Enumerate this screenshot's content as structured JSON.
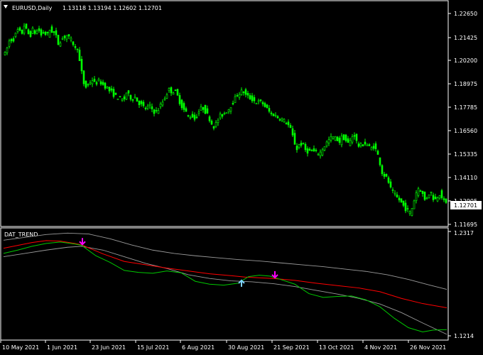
{
  "main_chart": {
    "symbol_label": "EURUSD,Daily",
    "ohlc_label": "1.13118 1.13194 1.12602 1.12701",
    "current_price": "1.12701",
    "price_ticks": [
      "1.22650",
      "1.21425",
      "1.20200",
      "1.18975",
      "1.17785",
      "1.16560",
      "1.15335",
      "1.14110",
      "1.12905",
      "1.11695"
    ],
    "colors": {
      "background": "#000000",
      "candle": "#00ff00",
      "frame": "#ffffff"
    }
  },
  "indicator": {
    "name": "DAT_TREND",
    "scale_top": "1.2317",
    "scale_bottom": "1.1214",
    "colors": {
      "fast": "#00c800",
      "slow": "#ff0000",
      "band": "#9a9a9a",
      "arrow_down": "#ff00ff",
      "arrow_up": "#7fd4ff"
    }
  },
  "time_axis": [
    "10 May 2021",
    "1 Jun 2021",
    "23 Jun 2021",
    "15 Jul 2021",
    "6 Aug 2021",
    "30 Aug 2021",
    "21 Sep 2021",
    "13 Oct 2021",
    "4 Nov 2021",
    "26 Nov 2021"
  ],
  "chart_data": {
    "type": "candlestick",
    "symbol": "EURUSD",
    "timeframe": "Daily",
    "y_range": [
      1.1155,
      1.2315
    ],
    "indicator_range": [
      1.1214,
      1.2317
    ],
    "close_path": [
      [
        0,
        1.213
      ],
      [
        4,
        1.208
      ],
      [
        8,
        1.2125
      ],
      [
        12,
        1.2175
      ],
      [
        16,
        1.2165
      ],
      [
        20,
        1.22
      ],
      [
        24,
        1.223
      ],
      [
        28,
        1.2195
      ],
      [
        32,
        1.225
      ],
      [
        36,
        1.2215
      ],
      [
        40,
        1.219
      ],
      [
        44,
        1.2225
      ],
      [
        48,
        1.2205
      ],
      [
        52,
        1.223
      ],
      [
        56,
        1.2195
      ],
      [
        60,
        1.2215
      ],
      [
        64,
        1.219
      ],
      [
        68,
        1.2225
      ],
      [
        72,
        1.2215
      ],
      [
        76,
        1.22
      ],
      [
        80,
        1.215
      ],
      [
        84,
        1.217
      ],
      [
        88,
        1.2185
      ],
      [
        92,
        1.2195
      ],
      [
        96,
        1.2175
      ],
      [
        100,
        1.216
      ],
      [
        104,
        1.212
      ],
      [
        108,
        1.213
      ],
      [
        110,
        1.205
      ],
      [
        113,
        1.199
      ],
      [
        116,
        1.193
      ],
      [
        120,
        1.1905
      ],
      [
        124,
        1.1935
      ],
      [
        128,
        1.195
      ],
      [
        132,
        1.1925
      ],
      [
        136,
        1.1945
      ],
      [
        140,
        1.1935
      ],
      [
        144,
        1.192
      ],
      [
        148,
        1.191
      ],
      [
        152,
        1.189
      ],
      [
        156,
        1.188
      ],
      [
        160,
        1.186
      ],
      [
        164,
        1.1855
      ],
      [
        168,
        1.1845
      ],
      [
        172,
        1.1835
      ],
      [
        176,
        1.188
      ],
      [
        180,
        1.186
      ],
      [
        184,
        1.1845
      ],
      [
        188,
        1.1855
      ],
      [
        192,
        1.183
      ],
      [
        196,
        1.1815
      ],
      [
        200,
        1.18
      ],
      [
        204,
        1.179
      ],
      [
        208,
        1.181
      ],
      [
        212,
        1.179
      ],
      [
        216,
        1.177
      ],
      [
        220,
        1.178
      ],
      [
        224,
        1.181
      ],
      [
        228,
        1.1835
      ],
      [
        232,
        1.187
      ],
      [
        236,
        1.1895
      ],
      [
        240,
        1.1885
      ],
      [
        244,
        1.189
      ],
      [
        248,
        1.186
      ],
      [
        252,
        1.182
      ],
      [
        256,
        1.179
      ],
      [
        260,
        1.177
      ],
      [
        264,
        1.1745
      ],
      [
        268,
        1.1755
      ],
      [
        272,
        1.1735
      ],
      [
        276,
        1.176
      ],
      [
        280,
        1.179
      ],
      [
        284,
        1.1795
      ],
      [
        288,
        1.177
      ],
      [
        292,
        1.1745
      ],
      [
        296,
        1.171
      ],
      [
        300,
        1.169
      ],
      [
        304,
        1.1725
      ],
      [
        308,
        1.175
      ],
      [
        312,
        1.176
      ],
      [
        316,
        1.1775
      ],
      [
        320,
        1.179
      ],
      [
        324,
        1.1815
      ],
      [
        328,
        1.184
      ],
      [
        332,
        1.187
      ],
      [
        336,
        1.188
      ],
      [
        340,
        1.189
      ],
      [
        344,
        1.1865
      ],
      [
        348,
        1.1855
      ],
      [
        352,
        1.1845
      ],
      [
        356,
        1.1835
      ],
      [
        360,
        1.1825
      ],
      [
        364,
        1.183
      ],
      [
        368,
        1.182
      ],
      [
        372,
        1.18
      ],
      [
        376,
        1.178
      ],
      [
        380,
        1.176
      ],
      [
        384,
        1.176
      ],
      [
        388,
        1.1745
      ],
      [
        392,
        1.174
      ],
      [
        396,
        1.173
      ],
      [
        400,
        1.172
      ],
      [
        404,
        1.17
      ],
      [
        408,
        1.167
      ],
      [
        412,
        1.161
      ],
      [
        416,
        1.157
      ],
      [
        420,
        1.16
      ],
      [
        424,
        1.1595
      ],
      [
        428,
        1.1565
      ],
      [
        432,
        1.1555
      ],
      [
        436,
        1.156
      ],
      [
        440,
        1.1555
      ],
      [
        444,
        1.155
      ],
      [
        448,
        1.1545
      ],
      [
        452,
        1.157
      ],
      [
        456,
        1.1595
      ],
      [
        460,
        1.1615
      ],
      [
        464,
        1.163
      ],
      [
        468,
        1.1635
      ],
      [
        472,
        1.1625
      ],
      [
        476,
        1.161
      ],
      [
        480,
        1.164
      ],
      [
        484,
        1.162
      ],
      [
        488,
        1.16
      ],
      [
        492,
        1.162
      ],
      [
        496,
        1.166
      ],
      [
        500,
        1.161
      ],
      [
        504,
        1.158
      ],
      [
        508,
        1.1595
      ],
      [
        512,
        1.16
      ],
      [
        516,
        1.159
      ],
      [
        520,
        1.157
      ],
      [
        524,
        1.1585
      ],
      [
        528,
        1.156
      ],
      [
        532,
        1.151
      ],
      [
        536,
        1.144
      ],
      [
        540,
        1.142
      ],
      [
        544,
        1.14
      ],
      [
        548,
        1.135
      ],
      [
        552,
        1.1325
      ],
      [
        556,
        1.1305
      ],
      [
        560,
        1.129
      ],
      [
        564,
        1.127
      ],
      [
        568,
        1.1245
      ],
      [
        572,
        1.123
      ],
      [
        576,
        1.1215
      ],
      [
        580,
        1.1275
      ],
      [
        584,
        1.133
      ],
      [
        588,
        1.136
      ],
      [
        592,
        1.133
      ],
      [
        596,
        1.129
      ],
      [
        600,
        1.131
      ],
      [
        604,
        1.134
      ],
      [
        608,
        1.13
      ],
      [
        612,
        1.129
      ],
      [
        616,
        1.133
      ],
      [
        620,
        1.131
      ],
      [
        624,
        1.127
      ]
    ],
    "indicator_lines": {
      "fast": [
        [
          0,
          1.2085
        ],
        [
          20,
          1.212
        ],
        [
          40,
          1.216
        ],
        [
          60,
          1.219
        ],
        [
          80,
          1.2205
        ],
        [
          100,
          1.2185
        ],
        [
          110,
          1.217
        ],
        [
          130,
          1.206
        ],
        [
          150,
          1.199
        ],
        [
          170,
          1.1905
        ],
        [
          190,
          1.1885
        ],
        [
          210,
          1.1875
        ],
        [
          230,
          1.19
        ],
        [
          250,
          1.188
        ],
        [
          270,
          1.179
        ],
        [
          290,
          1.176
        ],
        [
          310,
          1.175
        ],
        [
          330,
          1.177
        ],
        [
          345,
          1.184
        ],
        [
          360,
          1.1855
        ],
        [
          375,
          1.1845
        ],
        [
          390,
          1.181
        ],
        [
          410,
          1.176
        ],
        [
          430,
          1.166
        ],
        [
          450,
          1.162
        ],
        [
          470,
          1.163
        ],
        [
          490,
          1.1635
        ],
        [
          510,
          1.1595
        ],
        [
          530,
          1.152
        ],
        [
          550,
          1.14
        ],
        [
          570,
          1.13
        ],
        [
          590,
          1.1255
        ],
        [
          605,
          1.1275
        ],
        [
          624,
          1.128
        ]
      ],
      "slow": [
        [
          0,
          1.214
        ],
        [
          20,
          1.217
        ],
        [
          40,
          1.22
        ],
        [
          60,
          1.222
        ],
        [
          80,
          1.2215
        ],
        [
          100,
          1.219
        ],
        [
          110,
          1.2175
        ],
        [
          140,
          1.208
        ],
        [
          170,
          1.2
        ],
        [
          200,
          1.1965
        ],
        [
          230,
          1.193
        ],
        [
          260,
          1.19
        ],
        [
          290,
          1.187
        ],
        [
          320,
          1.185
        ],
        [
          340,
          1.1835
        ],
        [
          380,
          1.182
        ],
        [
          410,
          1.18
        ],
        [
          440,
          1.177
        ],
        [
          470,
          1.1745
        ],
        [
          500,
          1.172
        ],
        [
          530,
          1.168
        ],
        [
          560,
          1.161
        ],
        [
          590,
          1.1555
        ],
        [
          624,
          1.151
        ]
      ],
      "upper_band": [
        [
          0,
          1.2225
        ],
        [
          30,
          1.2255
        ],
        [
          60,
          1.2285
        ],
        [
          90,
          1.23
        ],
        [
          120,
          1.229
        ],
        [
          150,
          1.224
        ],
        [
          180,
          1.2175
        ],
        [
          210,
          1.212
        ],
        [
          240,
          1.2085
        ],
        [
          270,
          1.206
        ],
        [
          300,
          1.204
        ],
        [
          330,
          1.202
        ],
        [
          360,
          1.2005
        ],
        [
          390,
          1.1985
        ],
        [
          420,
          1.1965
        ],
        [
          450,
          1.1945
        ],
        [
          480,
          1.192
        ],
        [
          510,
          1.1895
        ],
        [
          540,
          1.186
        ],
        [
          570,
          1.181
        ],
        [
          600,
          1.175
        ],
        [
          624,
          1.1705
        ]
      ],
      "lower_band": [
        [
          0,
          1.205
        ],
        [
          30,
          1.2085
        ],
        [
          60,
          1.212
        ],
        [
          90,
          1.215
        ],
        [
          110,
          1.216
        ],
        [
          140,
          1.212
        ],
        [
          170,
          1.205
        ],
        [
          200,
          1.198
        ],
        [
          230,
          1.1925
        ],
        [
          260,
          1.186
        ],
        [
          290,
          1.182
        ],
        [
          320,
          1.1795
        ],
        [
          350,
          1.1785
        ],
        [
          380,
          1.1765
        ],
        [
          410,
          1.1735
        ],
        [
          440,
          1.1695
        ],
        [
          470,
          1.1655
        ],
        [
          500,
          1.161
        ],
        [
          530,
          1.155
        ],
        [
          560,
          1.146
        ],
        [
          590,
          1.135
        ],
        [
          624,
          1.123
        ]
      ]
    },
    "signals": [
      {
        "direction": "down",
        "x": 111,
        "price": 1.218
      },
      {
        "direction": "up",
        "x": 335,
        "price": 1.18
      },
      {
        "direction": "down",
        "x": 382,
        "price": 1.183
      }
    ]
  }
}
